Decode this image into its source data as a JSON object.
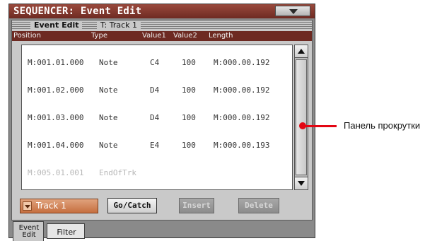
{
  "titlebar": {
    "title": "SEQUENCER: Event Edit",
    "menu_icon": "triangle-down-icon"
  },
  "panel_header": {
    "section": "Event Edit",
    "track": "T: Track 1"
  },
  "columns": [
    "Position",
    "Type",
    "Value1",
    "Value2",
    "Length"
  ],
  "events": [
    {
      "position": "M:001.01.000",
      "type": "Note",
      "value1": "C4",
      "value2": "100",
      "length": "M:000.00.192"
    },
    {
      "position": "M:001.02.000",
      "type": "Note",
      "value1": "D4",
      "value2": "100",
      "length": "M:000.00.192"
    },
    {
      "position": "M:001.03.000",
      "type": "Note",
      "value1": "D4",
      "value2": "100",
      "length": "M:000.00.192"
    },
    {
      "position": "M:001.04.000",
      "type": "Note",
      "value1": "E4",
      "value2": "100",
      "length": "M:000.00.193"
    },
    {
      "position": "M:005.01.001",
      "type": "EndOfTrk",
      "value1": "",
      "value2": "",
      "length": ""
    }
  ],
  "controls": {
    "track_select": "Track 1",
    "go_catch": "Go/Catch",
    "insert": "Insert",
    "delete": "Delete"
  },
  "tabs": {
    "event_edit_line1": "Event",
    "event_edit_line2": "Edit",
    "filter": "Filter"
  },
  "annotation": {
    "label": "Панель прокрутки"
  },
  "colors": {
    "title_bar": "#7a3228",
    "column_header": "#6d2a22",
    "track_selector": "#d58a5b",
    "pointer": "#e30613"
  }
}
